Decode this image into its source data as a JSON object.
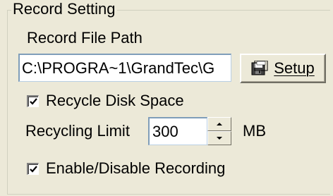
{
  "group": {
    "title": "Record Setting"
  },
  "record_path": {
    "label": "Record File Path",
    "value": "C:\\PROGRA~1\\GrandTec\\G"
  },
  "setup_button": {
    "label": "Setup",
    "icon": "floppy-disk-icon"
  },
  "recycle_disk_space": {
    "label": "Recycle Disk Space",
    "checked": true
  },
  "recycling_limit": {
    "label": "Recycling Limit",
    "value": "300",
    "unit": "MB"
  },
  "enable_recording": {
    "label": "Enable/Disable Recording",
    "checked": true
  },
  "colors": {
    "background": "#ece9d8",
    "input_border": "#7f9db9"
  }
}
